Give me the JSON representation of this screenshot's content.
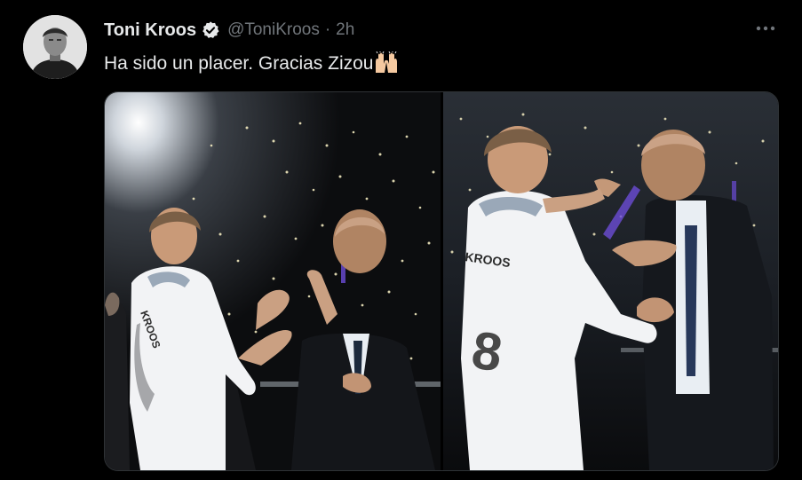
{
  "tweet": {
    "author_name": "Toni Kroos",
    "handle": "@ToniKroos",
    "separator": "·",
    "time": "2h",
    "text": "Ha sido un placer. Gracias Zizou",
    "emoji": "raising-hands-emoji",
    "jersey_text": "KROOS",
    "media_count": 2
  },
  "icons": {
    "verified": "verified-badge-icon",
    "more": "more-options-icon"
  },
  "colors": {
    "background": "#000000",
    "text_primary": "#e7e9ea",
    "text_secondary": "#71767b",
    "verified_badge": "#e7e9ea",
    "border": "#2f3336"
  }
}
